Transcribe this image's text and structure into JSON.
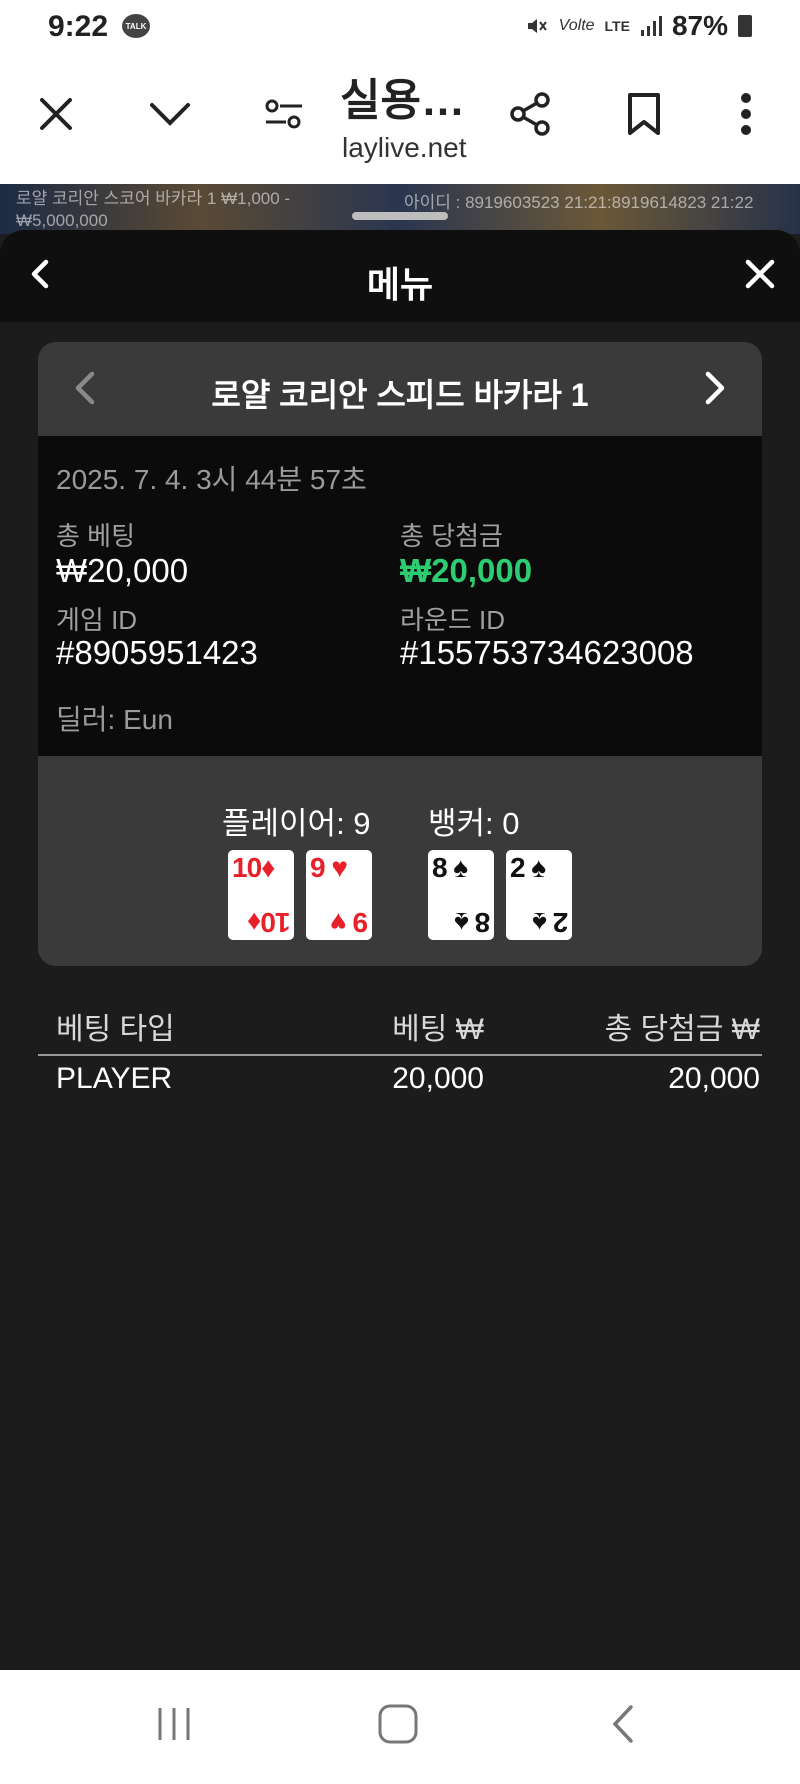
{
  "status_bar": {
    "time": "9:22",
    "talk_badge": "TALK",
    "network": "LTE",
    "battery": "87%"
  },
  "browser": {
    "page_title": "실용…",
    "url": "laylive.net"
  },
  "video": {
    "left_line1": "로얄 코리안 스코어 바카라 1 ₩1,000 -",
    "left_line2": "₩5,000,000",
    "right_text": "아이디 : 8919603523 21:21:8919614823 21:22"
  },
  "sheet": {
    "title": "메뉴"
  },
  "card": {
    "title": "로얄 코리안 스피드 바카라 1",
    "date": "2025. 7. 4. 3시 44분 57초",
    "total_bet_label": "총 베팅",
    "total_bet_value": "₩20,000",
    "total_win_label": "총 당첨금",
    "total_win_value": "₩20,000",
    "game_id_label": "게임 ID",
    "game_id_value": "#8905951423",
    "round_id_label": "라운드 ID",
    "round_id_value": "#155753734623008",
    "dealer": "딜러: Eun",
    "player_score": "플레이어: 9",
    "banker_score": "뱅커: 0",
    "player_cards": [
      {
        "rank": "10",
        "suit": "♦",
        "color": "#e8202a"
      },
      {
        "rank": "9",
        "suit": "♥",
        "color": "#e8202a"
      }
    ],
    "banker_cards": [
      {
        "rank": "8",
        "suit": "♠",
        "color": "#111111"
      },
      {
        "rank": "2",
        "suit": "♠",
        "color": "#111111"
      }
    ]
  },
  "table": {
    "headers": [
      "베팅 타입",
      "베팅 ₩",
      "총 당첨금 ₩"
    ],
    "rows": [
      {
        "type": "PLAYER",
        "bet": "20,000",
        "win": "20,000"
      }
    ]
  },
  "colors": {
    "win_green": "#2ecc71",
    "sheet_bg": "#1c1c1c",
    "card_bg": "#3a3a3a"
  }
}
